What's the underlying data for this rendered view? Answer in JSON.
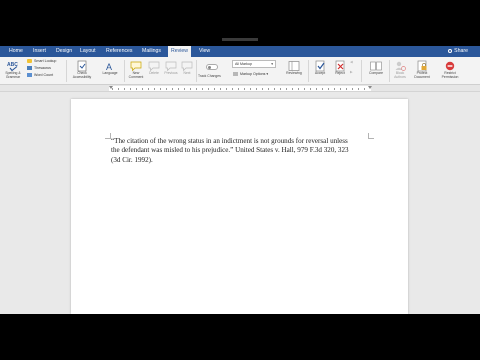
{
  "tabs": [
    {
      "label": "Home"
    },
    {
      "label": "Insert"
    },
    {
      "label": "Design"
    },
    {
      "label": "Layout"
    },
    {
      "label": "References"
    },
    {
      "label": "Mailings"
    },
    {
      "label": "Review"
    },
    {
      "label": "View"
    }
  ],
  "active_tab": "Review",
  "share_label": "Share",
  "ribbon": {
    "spelling_label": "Spelling & Grammar",
    "spelling_icon_text": "ABC",
    "proofing_small": [
      "Smart Lookup",
      "Thesaurus",
      "Word Count"
    ],
    "check_accessibility": "Check Accessibility",
    "language": "Language",
    "new_comment": "New Comment",
    "delete": "Delete",
    "previous": "Previous",
    "next": "Next",
    "track_changes": "Track Changes",
    "markup_select": "All Markup",
    "markup_options": "Markup Options",
    "reviewing": "Reviewing",
    "accept": "Accept",
    "reject": "Reject",
    "compare": "Compare",
    "block_authors": "Block Authors",
    "protect_document": "Protect Document",
    "restrict_permission": "Restrict Permission"
  },
  "document": {
    "line1": "“The citation of the wrong status in an indictment is not grounds for reversal unless",
    "line2": "the defendant was misled to his prejudice.” United States v. Hall, 979 F.3d 320, 323",
    "line3": "(3d Cir. 1992)."
  },
  "colors": {
    "brand_blue": "#2b579a",
    "ribbon_bg": "#f3f3f3",
    "workspace_bg": "#e9e9e9"
  }
}
